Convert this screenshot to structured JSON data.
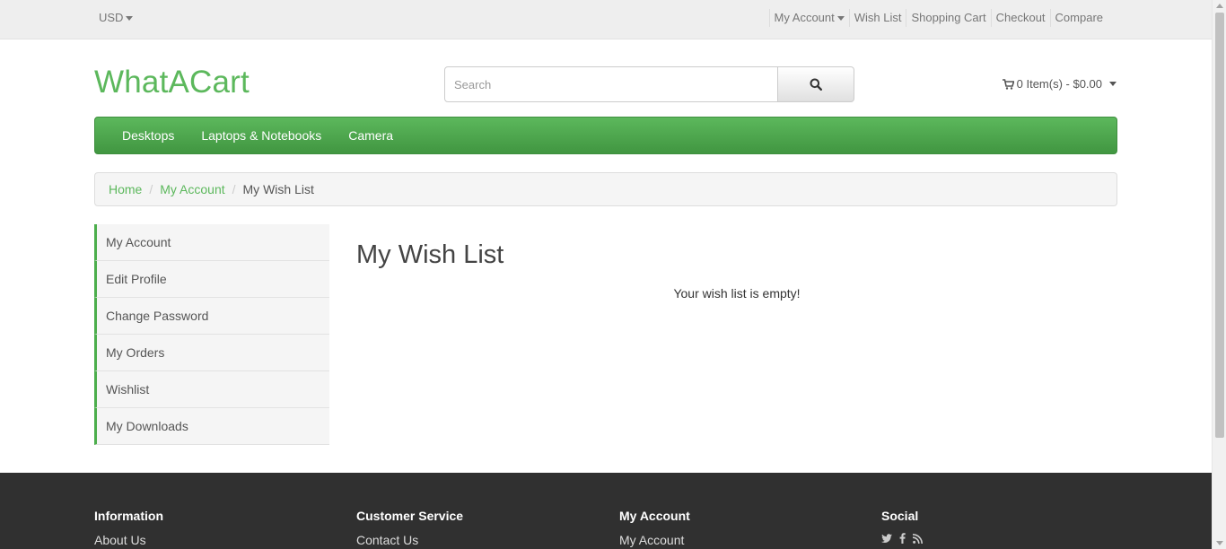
{
  "topbar": {
    "currency": "USD",
    "links": [
      "My Account",
      "Wish List",
      "Shopping Cart",
      "Checkout",
      "Compare"
    ]
  },
  "header": {
    "logo": "WhatACart",
    "search_placeholder": "Search",
    "cart_label": "0 Item(s) - $0.00"
  },
  "nav": {
    "items": [
      "Desktops",
      "Laptops & Notebooks",
      "Camera"
    ]
  },
  "breadcrumb": {
    "items": [
      "Home",
      "My Account"
    ],
    "current": "My Wish List"
  },
  "sidebar": {
    "items": [
      "My Account",
      "Edit Profile",
      "Change Password",
      "My Orders",
      "Wishlist",
      "My Downloads"
    ]
  },
  "main": {
    "title": "My Wish List",
    "empty_message": "Your wish list is empty!"
  },
  "footer": {
    "columns": [
      {
        "heading": "Information",
        "link": "About Us"
      },
      {
        "heading": "Customer Service",
        "link": "Contact Us"
      },
      {
        "heading": "My Account",
        "link": "My Account"
      },
      {
        "heading": "Social"
      }
    ],
    "social_icons": [
      "twitter-icon",
      "facebook-icon",
      "rss-icon"
    ]
  },
  "colors": {
    "accent": "#5cb85c",
    "footer_bg": "#303030",
    "topbar_bg": "#eeeeee"
  }
}
